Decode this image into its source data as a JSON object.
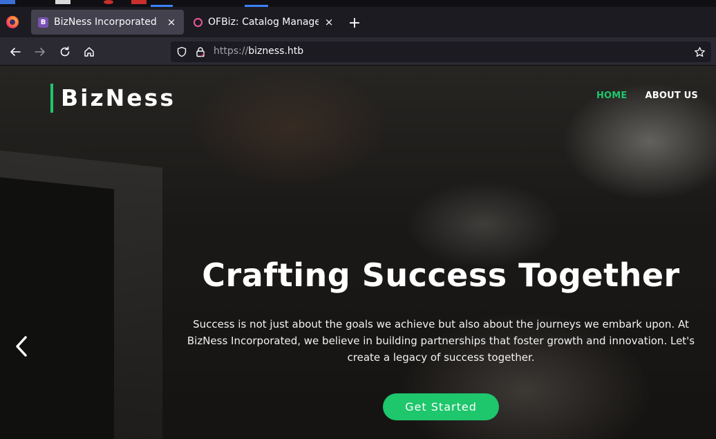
{
  "browser": {
    "tabs": [
      {
        "favicon": "B",
        "title": "BizNess Incorporated",
        "active": true
      },
      {
        "favicon": "ofbiz-icon",
        "title": "OFBiz: Catalog Manager: ",
        "active": false
      }
    ],
    "new_tab_label": "+",
    "close_glyph": "×",
    "url_scheme": "https://",
    "url_host": "bizness.htb"
  },
  "site": {
    "brand": "BizNess",
    "nav": [
      {
        "label": "HOME",
        "active": true
      },
      {
        "label": "ABOUT US",
        "active": false
      }
    ],
    "hero": {
      "title": "Crafting Success Together",
      "text": "Success is not just about the goals we achieve but also about the journeys we embark upon. At BizNess Incorporated, we believe in building partnerships that foster growth and innovation. Let's create a legacy of success together.",
      "button_label": "Get Started"
    }
  },
  "colors": {
    "accent": "#1ec66c",
    "tab_active_bg": "#42414d",
    "toolbar_bg": "#2b2a33"
  }
}
